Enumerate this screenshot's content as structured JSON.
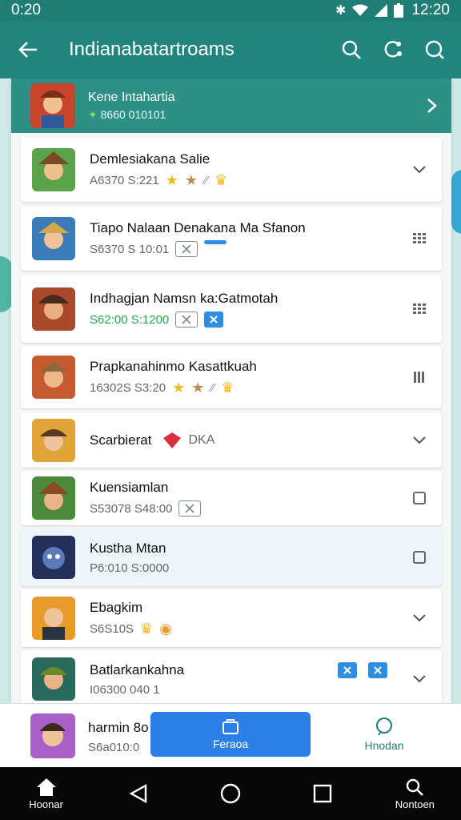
{
  "status": {
    "time_left": "0:20",
    "time_right": "12:20",
    "icons": [
      "bluetooth-icon",
      "wifi-icon",
      "signal-icon",
      "battery-icon"
    ]
  },
  "app_bar": {
    "title": "Indianabatartroams",
    "actions": [
      "search-icon",
      "share-icon",
      "help-icon"
    ]
  },
  "featured": {
    "name": "Kene Intahartia",
    "meta": "8660 010101"
  },
  "rows": [
    {
      "title": "Demlesiakana Salie",
      "meta": "A6370 S:221",
      "trailing": "chevron-down-icon"
    },
    {
      "title": "Tiapo Nalaan Denakana Ma Sfanon",
      "meta": "S6370 S 10:01",
      "trailing": "grid-icon"
    },
    {
      "title": "Indhagjan Namsn ka:Gatmotah",
      "meta": "S62:00 S:1200",
      "trailing": "grid-icon"
    },
    {
      "title": "Prapkanahinmo Kasattkuah",
      "meta": "16302S S3:20",
      "trailing": "list-icon"
    },
    {
      "title": "Scarbierat",
      "badge": "DKA",
      "trailing": "chevron-down-icon"
    },
    {
      "title": "Kuensiamlan",
      "meta": "S53078 S48:00",
      "trailing": "checkbox-icon"
    },
    {
      "title": "Kustha Mtan",
      "meta": "P6:010 S:0000",
      "trailing": "checkbox-icon"
    },
    {
      "title": "Ebagkim",
      "meta": "S6S10S",
      "trailing": "chevron-down-icon"
    },
    {
      "title": "Batlarkankahna",
      "meta": "I06300 040 1",
      "trailing": "chevron-down-icon"
    }
  ],
  "bottom_sheet": {
    "title": "harmin 8o",
    "meta": "S6a010:0",
    "primary_label": "Feraoa",
    "secondary_label": "Hnodan"
  },
  "nav": {
    "home_label": "Hoonar",
    "search_label": "Nontoen"
  },
  "colors": {
    "primary": "#22857d",
    "accent_blue": "#2b7fe6",
    "star": "#f5b91e"
  }
}
